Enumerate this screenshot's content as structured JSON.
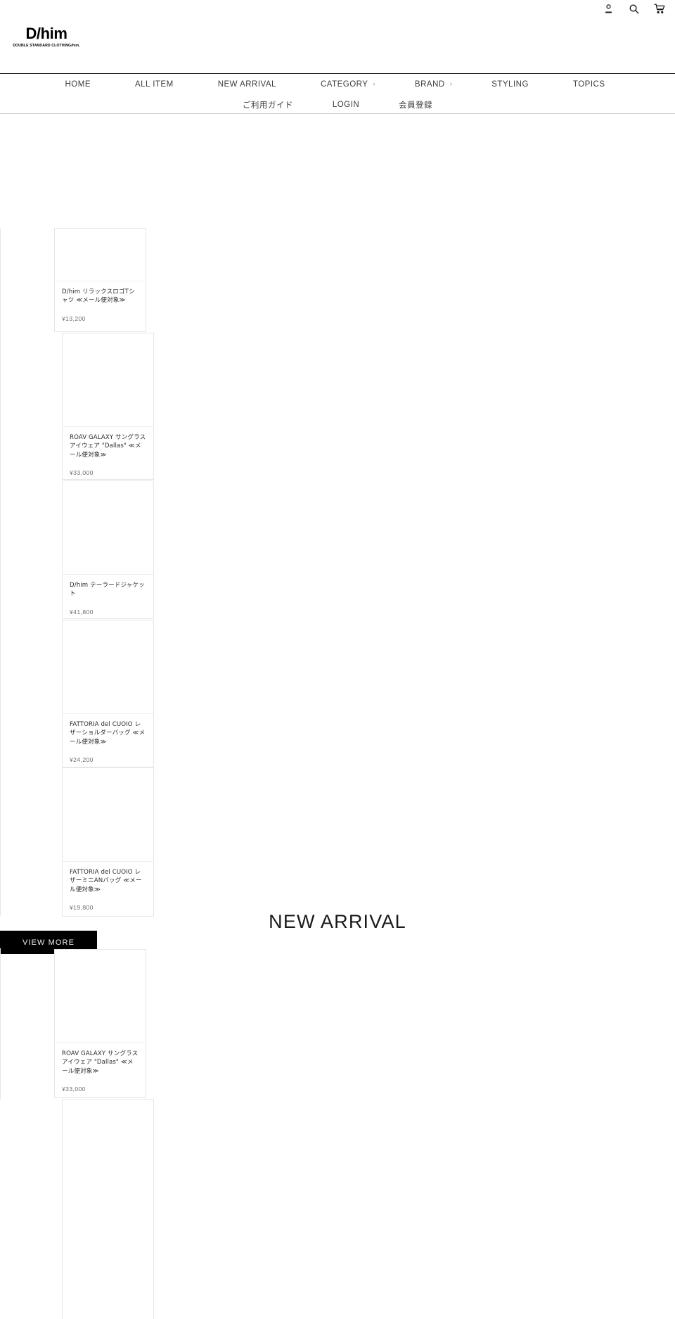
{
  "header": {
    "logo_main": "D/him",
    "logo_sub": "DOUBLE STANDARD CLOTHING/him.",
    "icons": [
      {
        "name": "account-icon",
        "label": "Account"
      },
      {
        "name": "search-icon",
        "label": "Search"
      },
      {
        "name": "cart-icon",
        "label": "Cart"
      }
    ]
  },
  "nav": {
    "row1": [
      {
        "label": "HOME",
        "caret": ""
      },
      {
        "label": "ALL ITEM",
        "caret": ""
      },
      {
        "label": "NEW ARRIVAL",
        "caret": ""
      },
      {
        "label": "CATEGORY",
        "caret": "›"
      },
      {
        "label": "BRAND",
        "caret": "›"
      },
      {
        "label": "STYLING",
        "caret": ""
      },
      {
        "label": "TOPICS",
        "caret": ""
      }
    ],
    "row2": [
      {
        "label": "ご利用ガイド",
        "caret": ""
      },
      {
        "label": "LOGIN",
        "caret": ""
      },
      {
        "label": "会員登録",
        "caret": ""
      }
    ]
  },
  "ranking_products": [
    {
      "title": "D/him リラックスロゴTシャツ ≪メール便対象≫",
      "price": "¥13,200"
    },
    {
      "title": "ROAV GALAXY サングラスアイウェア \"Dallas\" ≪メール便対象≫",
      "price": "¥33,000"
    },
    {
      "title": "D/him テーラードジャケット",
      "price": "¥41,800"
    },
    {
      "title": "FATTORIA del CUOIO レザーショルダーバッグ ≪メール便対象≫",
      "price": "¥24,200"
    },
    {
      "title": "FATTORIA del CUOIO レザーミニANバッグ ≪メール便対象≫",
      "price": "¥19,800"
    }
  ],
  "view_more": {
    "label": "VIEW MORE"
  },
  "new_arrival": {
    "title": "NEW ARRIVAL",
    "products": [
      {
        "title": "ROAV GALAXY サングラスアイウェア \"Dallas\" ≪メール便対象≫",
        "price": "¥33,000"
      }
    ]
  }
}
